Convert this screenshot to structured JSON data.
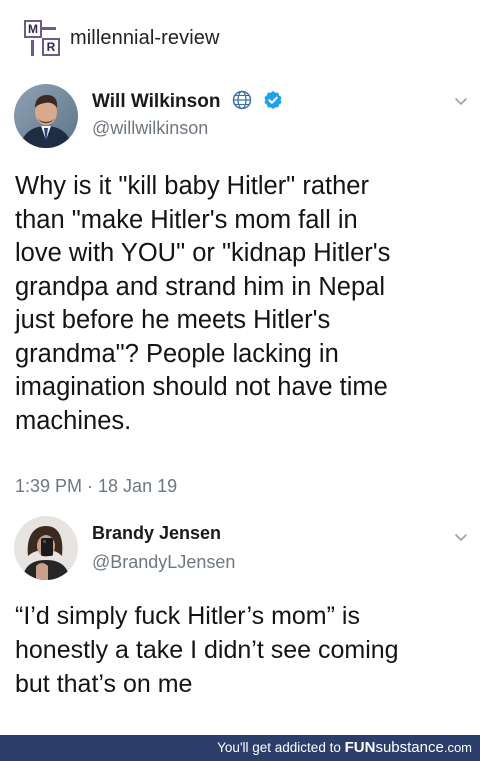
{
  "header": {
    "logo_letters": [
      "M",
      "R"
    ],
    "site_name": "millennial-review"
  },
  "tweets": [
    {
      "display_name": "Will Wilkinson",
      "handle": "@willwilkinson",
      "badges": [
        "globe-icon",
        "verified-badge-icon"
      ],
      "text": "Why is it \"kill baby Hitler\" rather\nthan \"make Hitler's mom fall in\nlove with YOU\" or \"kidnap Hitler's\ngrandpa and strand him in Nepal\njust before he meets Hitler's\ngrandma\"?  People lacking in\nimagination should not have time\nmachines.",
      "timestamp": "1:39 PM · 18 Jan 19"
    },
    {
      "display_name": "Brandy Jensen",
      "handle": "@BrandyLJensen",
      "badges": [],
      "text": "“I’d simply fuck Hitler’s mom” is\nhonestly a take I didn’t see coming\nbut that’s on me"
    }
  ],
  "footer": {
    "prefix": "You'll get addicted to",
    "brand_bold": "FUN",
    "brand_light": "substance",
    "tld": ".com"
  },
  "colors": {
    "verified_blue": "#1da1f2",
    "footer_bg": "#2c3e6b",
    "handle_gray": "#6e7780",
    "logo_purple": "#6d5b8c"
  }
}
